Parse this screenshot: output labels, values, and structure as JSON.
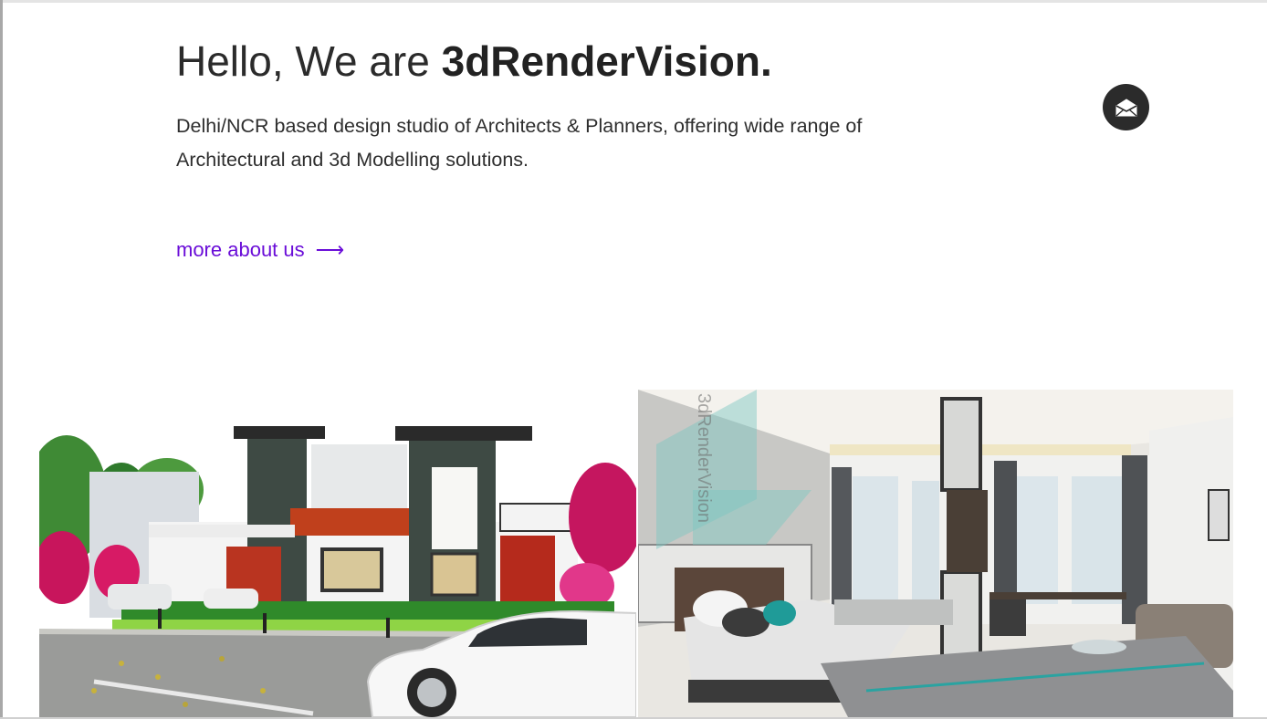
{
  "hero": {
    "title_prefix": "Hello, We are ",
    "title_brand": "3dRenderVision.",
    "description": "Delhi/NCR based design studio of Architects & Planners, offering wide range of Architectural and 3d Modelling solutions.",
    "more_link_label": "more about us",
    "more_link_arrow": "⟶"
  },
  "contact": {
    "icon": "envelope-icon"
  },
  "gallery": {
    "left_image": "villa-exterior-render",
    "right_image": "hotel-bedroom-interior-render",
    "watermark_text": "3dRenderVision"
  },
  "colors": {
    "link": "#6a0dd8",
    "text": "#2b2b2b",
    "mail_button_bg": "#2b2b2b"
  }
}
